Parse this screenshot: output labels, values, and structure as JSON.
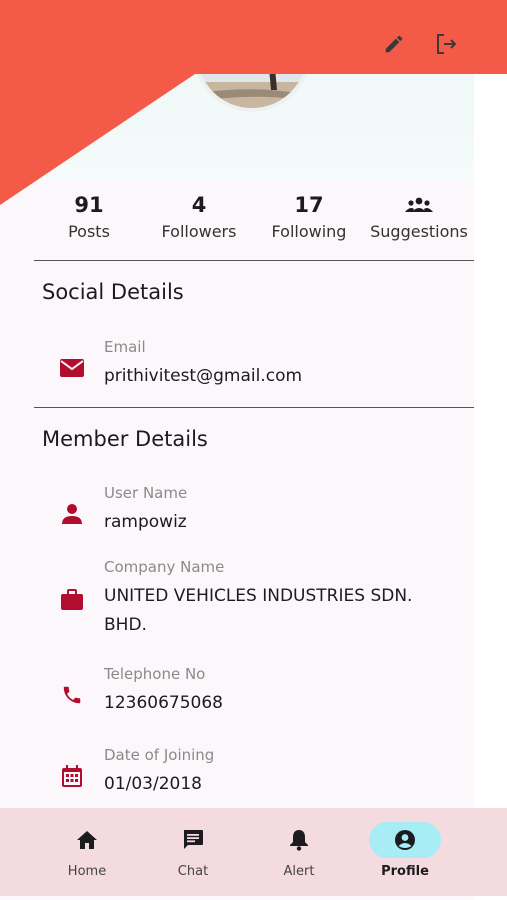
{
  "stats": [
    {
      "value": "91",
      "label": "Posts"
    },
    {
      "value": "4",
      "label": "Followers"
    },
    {
      "value": "17",
      "label": "Following"
    },
    {
      "label": "Suggestions",
      "icon": "group-icon"
    }
  ],
  "social": {
    "title": "Social Details",
    "email": {
      "label": "Email",
      "value": "prithivitest@gmail.com",
      "icon": "mail-icon"
    }
  },
  "member": {
    "title": "Member Details",
    "user_name": {
      "label": "User Name",
      "value": "rampowiz",
      "icon": "person-icon"
    },
    "company": {
      "label": "Company Name",
      "value": "UNITED VEHICLES INDUSTRIES SDN. BHD.",
      "icon": "briefcase-icon"
    },
    "telephone": {
      "label": "Telephone No",
      "value": "12360675068",
      "icon": "phone-icon"
    },
    "joining": {
      "label": "Date of Joining",
      "value": "01/03/2018",
      "icon": "calendar-icon"
    }
  },
  "nav": [
    {
      "label": "Home",
      "icon": "home-icon"
    },
    {
      "label": "Chat",
      "icon": "chat-icon"
    },
    {
      "label": "Alert",
      "icon": "bell-icon"
    },
    {
      "label": "Profile",
      "icon": "account-circle-icon",
      "active": true
    }
  ],
  "colors": {
    "accent": "#f45a48",
    "icon": "#b00d2f",
    "nav_bg": "#f4dbe0",
    "active_pill": "#a8ecf6"
  }
}
